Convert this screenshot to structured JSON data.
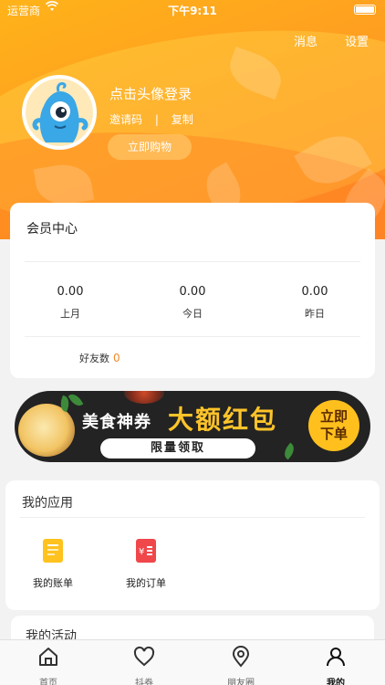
{
  "status": {
    "carrier": "运营商",
    "time": "下午9:11"
  },
  "header": {
    "messages": "消息",
    "settings": "设置"
  },
  "profile": {
    "login": "点击头像登录",
    "invite_code": "邀请码",
    "separator": "|",
    "copy": "复制",
    "buy": "立即购物"
  },
  "member": {
    "title": "会员中心",
    "stats": [
      {
        "value": "0.00",
        "label": "上月"
      },
      {
        "value": "0.00",
        "label": "今日"
      },
      {
        "value": "0.00",
        "label": "昨日"
      }
    ],
    "friends_label": "好友数",
    "friends_count": "0"
  },
  "banner": {
    "left_text": "美食神券",
    "big_text": "大额红包",
    "pill": "限量领取",
    "cta_line1": "立即",
    "cta_line2": "下单"
  },
  "apps": {
    "title": "我的应用",
    "items": [
      {
        "label": "我的账单",
        "icon": "bill-icon"
      },
      {
        "label": "我的订单",
        "icon": "order-icon"
      }
    ]
  },
  "activity": {
    "title": "我的活动"
  },
  "tabbar": [
    {
      "label": "首页",
      "icon": "home-icon"
    },
    {
      "label": "抖券",
      "icon": "heart-icon"
    },
    {
      "label": "朋友圈",
      "icon": "location-icon"
    },
    {
      "label": "我的",
      "icon": "person-icon",
      "active": true
    }
  ],
  "colors": {
    "accent": "#ff9a22",
    "friends_count": "#f08a2a",
    "banner_bg": "#232323",
    "banner_yellow": "#ffc42a"
  }
}
